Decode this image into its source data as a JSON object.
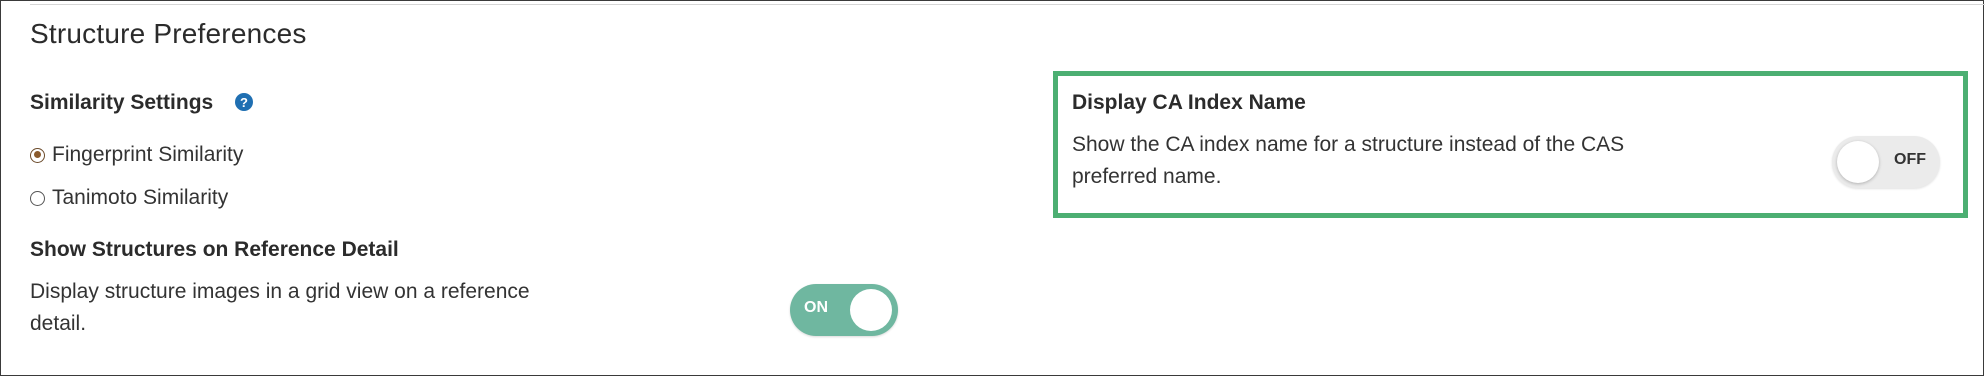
{
  "section": {
    "title": "Structure Preferences"
  },
  "similarity": {
    "heading": "Similarity Settings",
    "help_icon": "question-mark-icon",
    "help_glyph": "?",
    "options": [
      {
        "label": "Fingerprint Similarity",
        "selected": true
      },
      {
        "label": "Tanimoto Similarity",
        "selected": false
      }
    ]
  },
  "structures_on_reference": {
    "heading": "Show Structures on Reference Detail",
    "description_line1": "Display structure images in a grid view on a reference",
    "description_line2": "detail.",
    "toggle_label": "ON",
    "toggle_state": true
  },
  "ca_index_name": {
    "heading": "Display CA Index Name",
    "description_line1": "Show the CA index name for a structure instead of the CAS",
    "description_line2": "preferred name.",
    "toggle_label": "OFF",
    "toggle_state": false
  },
  "colors": {
    "toggle_on": "#6fb7a0",
    "toggle_off": "#ebebeb",
    "highlight": "#4caf72",
    "help_icon": "#1f6fb2"
  }
}
